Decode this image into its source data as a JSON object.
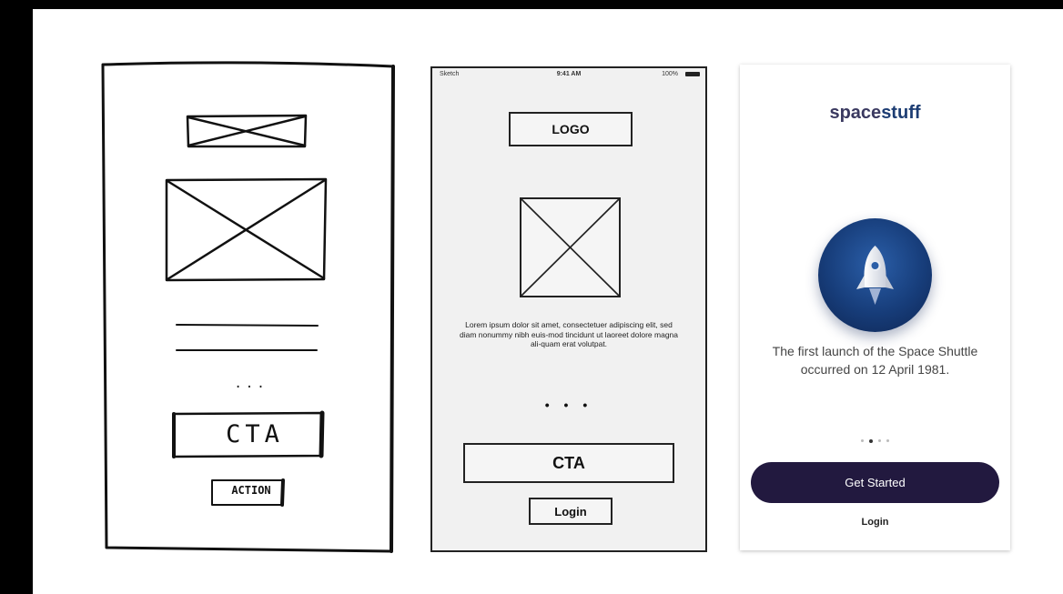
{
  "sketch": {
    "cta_label": "CTA",
    "dots": "...",
    "action_label": "ACTION"
  },
  "wireframe": {
    "status_carrier": "Sketch",
    "status_time": "9:41 AM",
    "status_battery": "100%",
    "logo_label": "LOGO",
    "lorem": "Lorem ipsum dolor sit amet, consectetuer adipiscing elit, sed diam nonummy nibh euis-mod tincidunt ut laoreet dolore magna ali-quam erat volutpat.",
    "dots": "• • •",
    "cta_label": "CTA",
    "login_label": "Login"
  },
  "final": {
    "logo_main": "space",
    "logo_accent": "stuff",
    "caption": "The first launch of the Space Shuttle occurred on 12 April 1981.",
    "page_count": 4,
    "active_page": 2,
    "cta_label": "Get Started",
    "login_label": "Login",
    "brand_color": "#22193f",
    "hero_icon": "rocket-icon"
  }
}
